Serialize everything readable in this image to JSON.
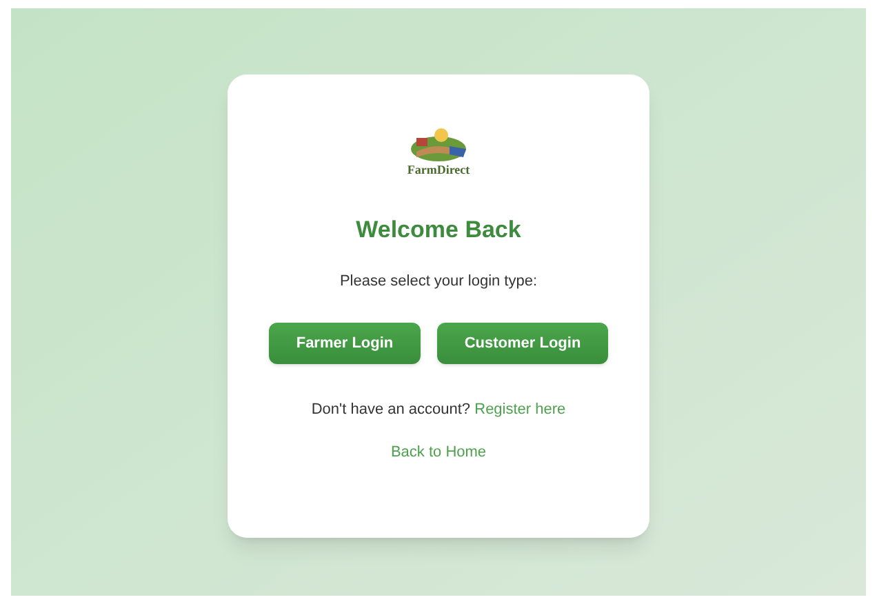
{
  "logo": {
    "text": "FarmDirect"
  },
  "title": "Welcome Back",
  "prompt": "Please select your login type:",
  "buttons": [
    {
      "label": "Farmer Login"
    },
    {
      "label": "Customer Login"
    }
  ],
  "register": {
    "text": "Don't have an account?",
    "link": "Register here"
  },
  "back_link": "Back to Home"
}
